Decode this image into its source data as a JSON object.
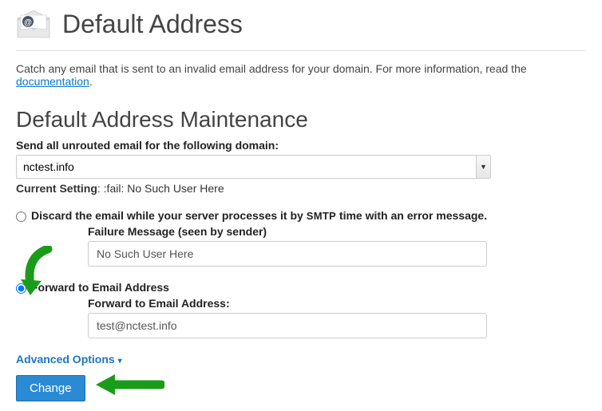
{
  "header": {
    "title": "Default Address"
  },
  "intro": {
    "text_before": "Catch any email that is sent to an invalid email address for your domain. For more information, read the ",
    "link": "documentation",
    "text_after": "."
  },
  "section_title": "Default Address Maintenance",
  "domain": {
    "label": "Send all unrouted email for the following domain:",
    "value": "nctest.info"
  },
  "current_setting": {
    "label": "Current Setting",
    "value": ": :fail: No Such User Here"
  },
  "option_discard": {
    "label_before": "Discard the email while your server processes it by ",
    "smtp": "SMTP",
    "label_after": " time with an error message.",
    "failure_label": "Failure Message (seen by sender)",
    "failure_value": "No Such User Here"
  },
  "option_forward": {
    "label": "Forward to Email Address",
    "sub_label": "Forward to Email Address:",
    "value": "test@nctest.info"
  },
  "advanced": {
    "label": "Advanced Options"
  },
  "button": {
    "change": "Change"
  }
}
